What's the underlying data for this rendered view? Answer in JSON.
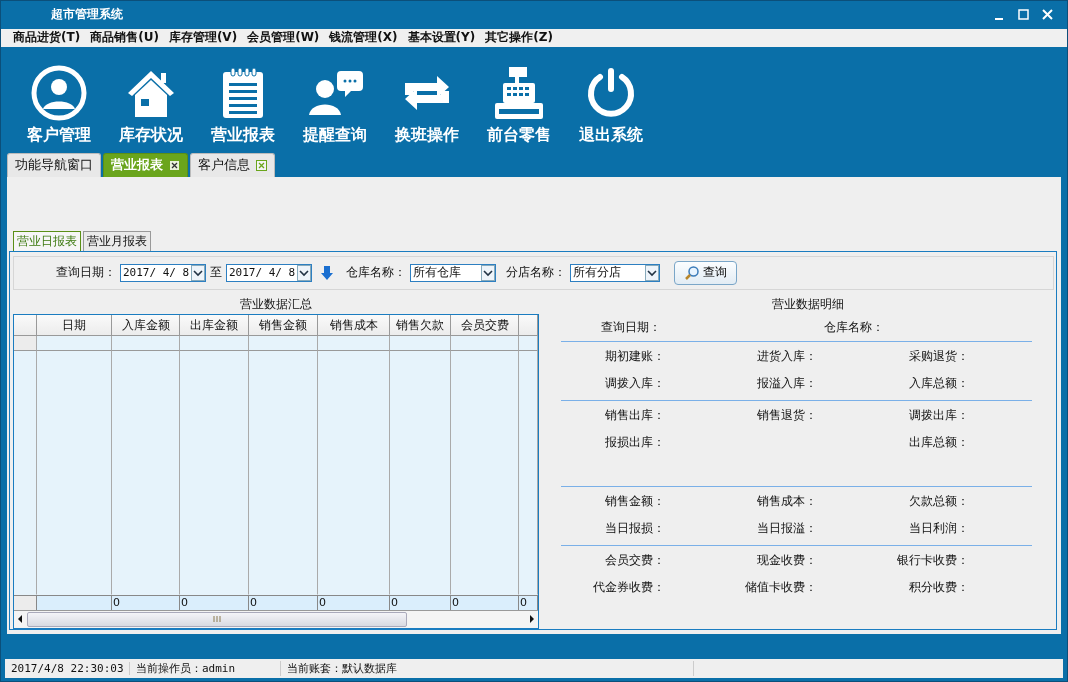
{
  "window": {
    "title": "超市管理系统"
  },
  "menu": [
    "商品进货(T)",
    "商品销售(U)",
    "库存管理(V)",
    "会员管理(W)",
    "钱流管理(X)",
    "基本设置(Y)",
    "其它操作(Z)"
  ],
  "toolbar": [
    {
      "label": "客户管理",
      "kind": "user"
    },
    {
      "label": "库存状况",
      "kind": "house"
    },
    {
      "label": "营业报表",
      "kind": "notepad"
    },
    {
      "label": "提醒查询",
      "kind": "chat"
    },
    {
      "label": "换班操作",
      "kind": "swap"
    },
    {
      "label": "前台零售",
      "kind": "register"
    },
    {
      "label": "退出系统",
      "kind": "power"
    }
  ],
  "tabs": [
    {
      "label": "功能导航窗口",
      "selected": false,
      "closable": false
    },
    {
      "label": "营业报表",
      "selected": true,
      "closable": true
    },
    {
      "label": "客户信息",
      "selected": false,
      "closable": true
    }
  ],
  "report_tabs": [
    {
      "label": "营业日报表",
      "selected": true
    },
    {
      "label": "营业月报表",
      "selected": false
    }
  ],
  "query": {
    "date_label": "查询日期：",
    "date_from": "2017/ 4/ 8",
    "to": "至",
    "date_to": "2017/ 4/ 8",
    "warehouse_label": "仓库名称：",
    "warehouse": "所有仓库",
    "branch_label": "分店名称：",
    "branch": "所有分店",
    "button": "查询"
  },
  "summary": {
    "title": "营业数据汇总",
    "columns": [
      "日期",
      "入库金额",
      "出库金额",
      "销售金额",
      "销售成本",
      "销售欠款",
      "会员交费"
    ],
    "totals": [
      "0",
      "0",
      "0",
      "0",
      "0",
      "0",
      "0"
    ]
  },
  "details": {
    "title": "营业数据明细",
    "header": {
      "left": "查询日期：",
      "middle": "仓库名称："
    },
    "sections": [
      {
        "rows": [
          {
            "left": "期初建账：",
            "middle": "进货入库：",
            "right": "采购退货："
          },
          {
            "left": "调拨入库：",
            "middle": "报溢入库：",
            "right": "入库总额："
          }
        ]
      },
      {
        "rows": [
          {
            "left": "销售出库：",
            "middle": "销售退货：",
            "right": "调拨出库："
          },
          {
            "left": "报损出库：",
            "right": "出库总额："
          }
        ]
      },
      {
        "rows": [
          {
            "left": "销售金额：",
            "middle": "销售成本：",
            "right": "欠款总额："
          },
          {
            "left": "当日报损：",
            "middle": "当日报溢：",
            "right": "当日利润："
          }
        ]
      },
      {
        "rows": [
          {
            "left": "会员交费：",
            "middle": "现金收费：",
            "right": "银行卡收费："
          },
          {
            "left": "代金券收费：",
            "middle": "储值卡收费：",
            "right": "积分收费："
          }
        ]
      }
    ]
  },
  "status_bar": [
    "2017/4/8 22:30:03",
    "当前操作员：admin",
    "当前账套：默认数据库"
  ]
}
